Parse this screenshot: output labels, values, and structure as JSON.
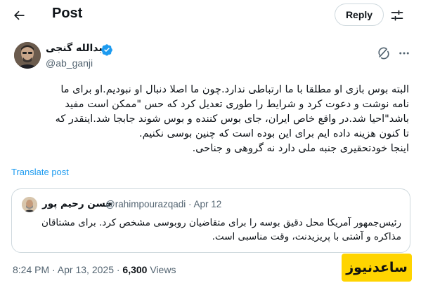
{
  "header": {
    "title": "Post",
    "reply_label": "Reply",
    "back_icon": "arrow-left-icon",
    "settings_icon": "sliders-icon"
  },
  "author": {
    "name": "عبدالله گنجی",
    "handle": "@ab_ganji",
    "verified_color": "#1d9bf0"
  },
  "tweet": {
    "lines": [
      "البته بوس بازی او مطلقا با ما ارتباطی ندارد.چون ما اصلا دنبال او نبودیم.او برای ما",
      "نامه نوشت و دعوت کرد و شرایط را طوری تعدیل کرد که حس \"ممکن است مفید",
      "باشد\"احیا شد.در واقع خاص ایران، جای بوس کننده و بوس شوند جابجا شد.اینقدر که",
      "تا کنون هزینه داده ایم برای این بوده است که چنین بوسی نکنیم.",
      "اینجا خودتحقیری جنبه ملی دارد نه گروهی و جناحی."
    ],
    "translate_label": "Translate post"
  },
  "quote": {
    "name": "حسن رحیم پور",
    "handle_date": "@rahimpourazqadi · Apr 12",
    "lines": [
      "رئیس‌جمهور آمریکا محل دقیق بوسه را برای متقاضیان روبوسی مشخص کرد. برای مشتاقان",
      "مذاکره و آشتی با پریزیدنت، وقت مناسبی است."
    ]
  },
  "meta": {
    "timestamp": "8:24 PM · Apr 13, 2025 · ",
    "views_count": "6,300",
    "views_label": " Views"
  },
  "watermark": {
    "text": "ساعدنیوز"
  },
  "colors": {
    "accent": "#1d9bf0",
    "secondary_text": "#536471",
    "border": "#cfd9de",
    "watermark_bg": "#ffd400"
  }
}
